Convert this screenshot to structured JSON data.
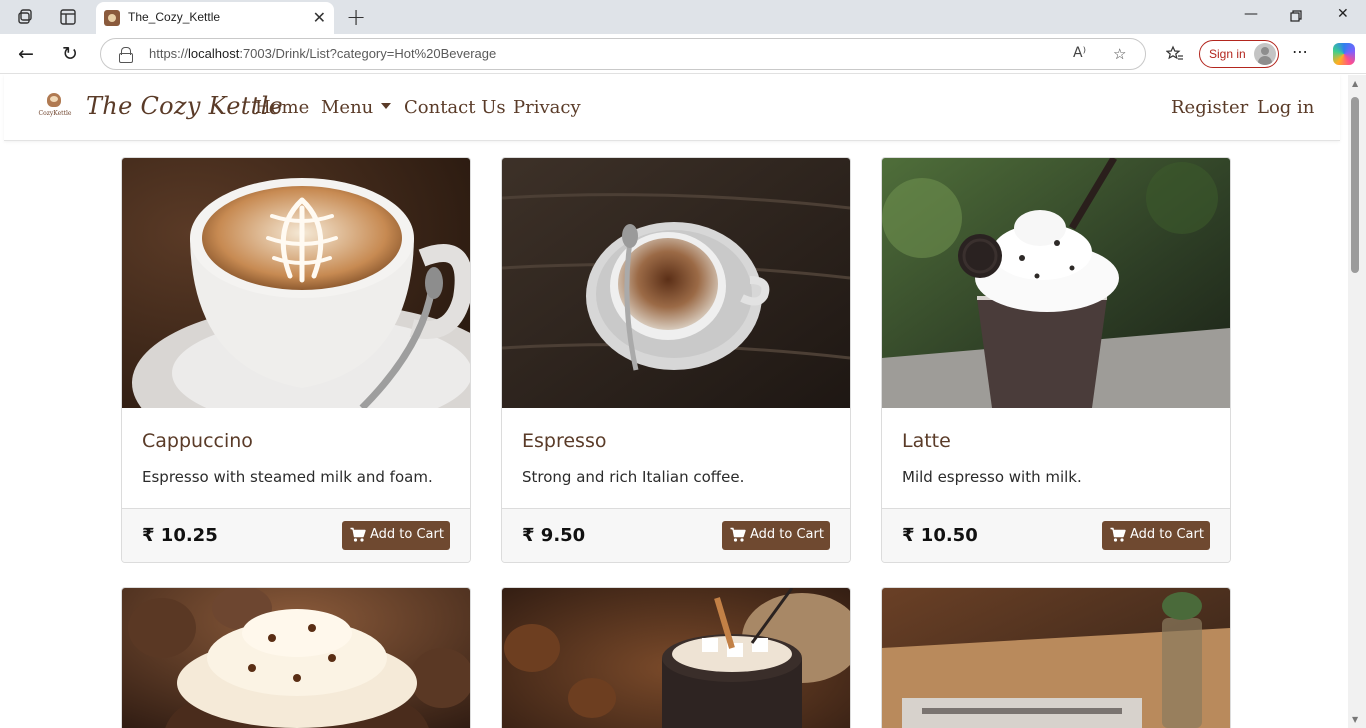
{
  "browser": {
    "tab_title": "The_Cozy_Kettle",
    "url_prefix": "https://",
    "url_host": "localhost",
    "url_rest": ":7003/Drink/List?category=Hot%20Beverage",
    "sign_in": "Sign in"
  },
  "site": {
    "logo_text": "CozyKettle",
    "brand": "The Cozy Kettle",
    "nav": {
      "home": "Home",
      "menu": "Menu",
      "contact": "Contact Us",
      "privacy": "Privacy",
      "register": "Register",
      "login": "Log in"
    }
  },
  "products": [
    {
      "name": "Cappuccino",
      "description": "Espresso with steamed milk and foam.",
      "price": "₹ 10.25",
      "button": "Add to Cart"
    },
    {
      "name": "Espresso",
      "description": "Strong and rich Italian coffee.",
      "price": "₹ 9.50",
      "button": "Add to Cart"
    },
    {
      "name": "Latte",
      "description": "Mild espresso with milk.",
      "price": "₹ 10.50",
      "button": "Add to Cart"
    }
  ],
  "colors": {
    "brand": "#5a3b28",
    "button": "#6f4930",
    "sign_in": "#b3261e"
  }
}
